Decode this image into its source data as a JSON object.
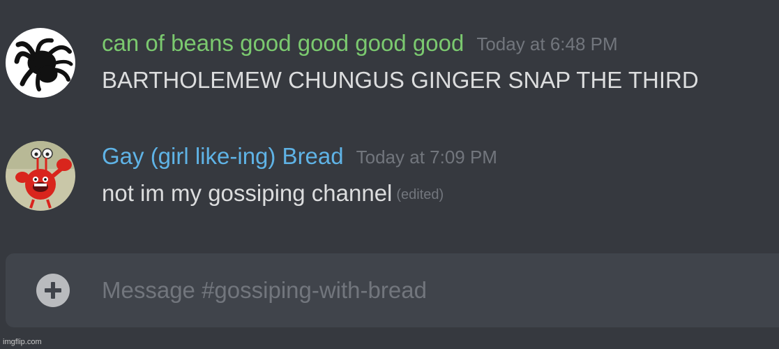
{
  "messages": [
    {
      "username": "can of beans good good good good",
      "username_color": "#7bc96f",
      "timestamp": "Today at 6:48 PM",
      "text": "BARTHOLEMEW CHUNGUS GINGER SNAP THE THIRD",
      "edited_label": "",
      "avatar_icon": "spider-avatar-icon"
    },
    {
      "username": "Gay (girl like-ing) Bread",
      "username_color": "#5fb3e6",
      "timestamp": "Today at 7:09 PM",
      "text": "not im my gossiping channel",
      "edited_label": "(edited)",
      "avatar_icon": "red-cartoon-character-avatar-icon"
    }
  ],
  "composer": {
    "placeholder": "Message #gossiping-with-bread",
    "value": "",
    "add_icon": "plus-circle-icon"
  },
  "watermark": "imgflip.com",
  "colors": {
    "background": "#36393f",
    "composer_background": "#40444b",
    "message_text": "#dcddde",
    "muted_text": "#72767d"
  }
}
